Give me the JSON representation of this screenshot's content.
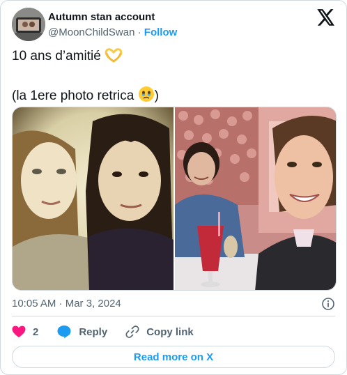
{
  "author": {
    "display_name": "Autumn stan account",
    "handle": "@MoonChildSwan",
    "separator": "·",
    "follow_label": "Follow"
  },
  "tweet": {
    "line1": "10 ans d’amitié",
    "line1_emoji": "heart-hands-emoji",
    "line2_prefix": "(la 1ere photo retrica",
    "line2_emoji": "face-holding-back-tears-emoji",
    "line2_suffix": ")"
  },
  "media": {
    "photos": [
      {
        "name": "photo-1",
        "style": "retrica vintage vignette selfie of two girls"
      },
      {
        "name": "photo-2",
        "style": "selfie in pink cafe with flower wall and red drink"
      }
    ]
  },
  "meta": {
    "timestamp": "10:05 AM · Mar 3, 2024",
    "info_icon": "info-icon"
  },
  "actions": {
    "like_count": "2",
    "reply_label": "Reply",
    "copy_label": "Copy link"
  },
  "footer": {
    "read_more": "Read more on X"
  },
  "colors": {
    "accent": "#1d9bf0",
    "like": "#f91880",
    "text_secondary": "#536471",
    "border": "#cfd9de"
  }
}
